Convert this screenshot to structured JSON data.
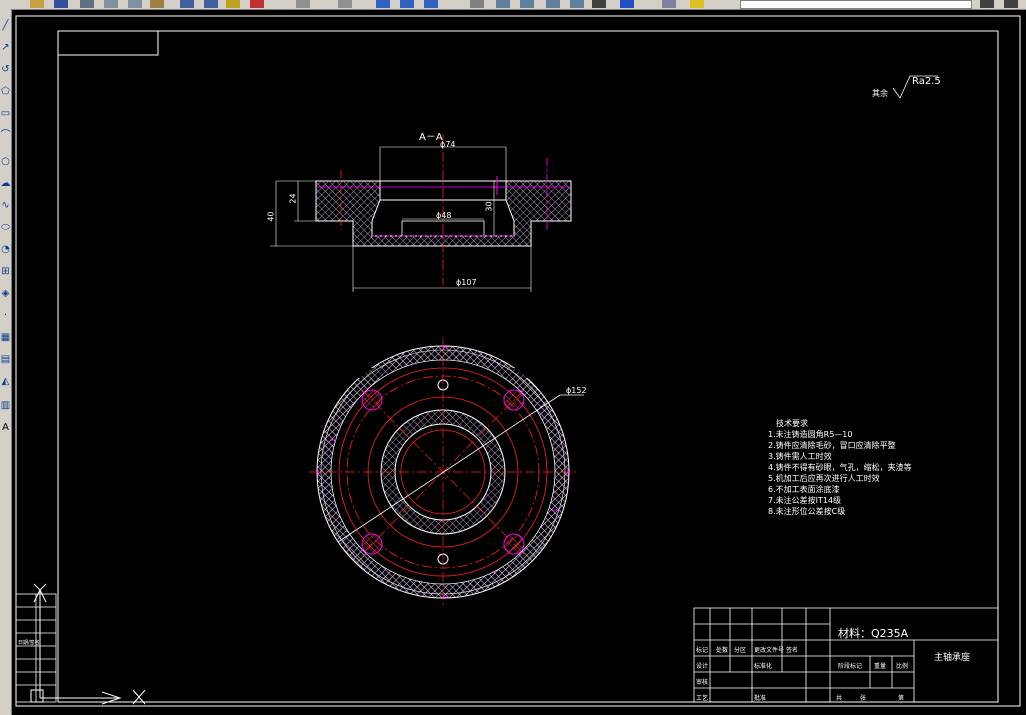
{
  "app": {
    "toolbar_colors": {
      "bg": "#d4d0c8",
      "canvas": "#000000"
    },
    "left_toolbar_last_glyph": "A"
  },
  "drawing": {
    "section_label": "A－A",
    "dims": {
      "d74": "ϕ74",
      "d48": "ϕ48",
      "d107": "ϕ107",
      "d152": "ϕ152",
      "h24": "24",
      "h40": "40",
      "h30": "30"
    },
    "roughness": {
      "prefix": "其余",
      "value": "Ra2.5"
    },
    "tech": {
      "title": "技术要求",
      "items": [
        "1.未注铸造圆角R5—10",
        "2.铸件应清除毛砂，冒口应清除平整",
        "3.铸件需人工时效",
        "4.铸件不得有砂眼，气孔，缩松，夹渣等",
        "5.机加工后应再次进行人工时效",
        "6.不加工表面涂底漆",
        "7.未注公差按IT14级",
        "8.未注形位公差按C级"
      ]
    },
    "title_block": {
      "material": "材料：Q235A",
      "name": "主轴承座",
      "cells": [
        "标记",
        "处数",
        "分区",
        "更改文件号",
        "签名",
        "设计",
        "审核",
        "工艺",
        "标准化",
        "批准",
        "阶段标记",
        "重量",
        "比例",
        "共",
        "张",
        "第"
      ]
    },
    "left_stamp": {
      "label": "日期/签名"
    },
    "colors": {
      "red": "#ff2020",
      "magenta": "#ff00ff",
      "white": "#ffffff",
      "hatch": "#e8c8ff"
    }
  }
}
